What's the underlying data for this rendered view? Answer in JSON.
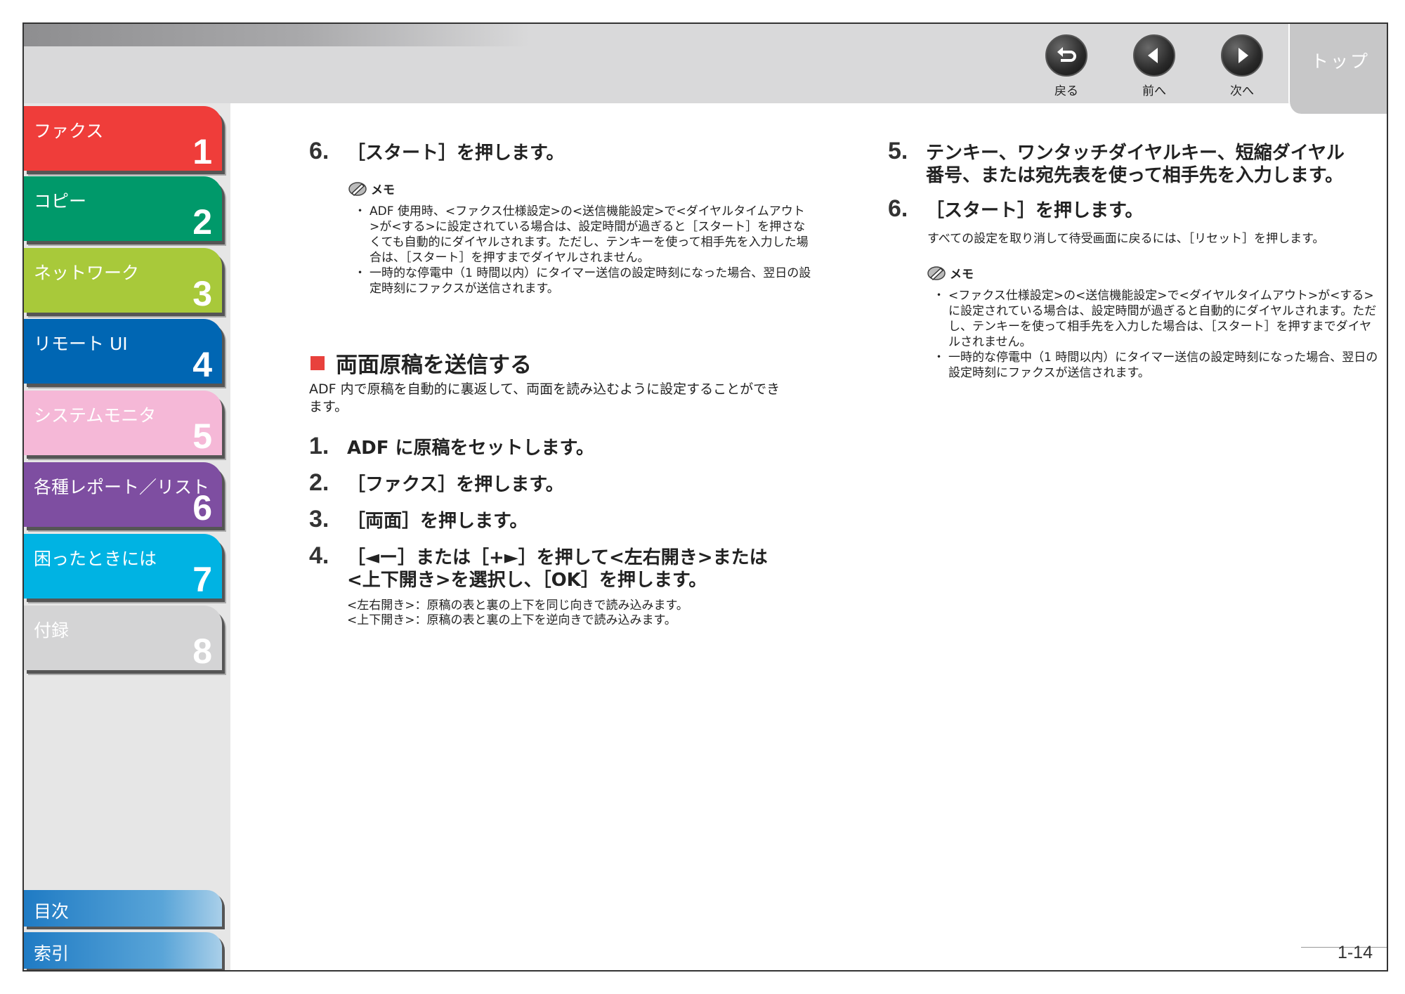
{
  "nav": {
    "back_label": "戻る",
    "prev_label": "前へ",
    "next_label": "次へ",
    "top_label": "トップ"
  },
  "sidebar": {
    "chapters": [
      {
        "name": "ファクス",
        "number": "1",
        "color": "#ef3d3a"
      },
      {
        "name": "コピー",
        "number": "2",
        "color": "#00996a"
      },
      {
        "name": "ネットワーク",
        "number": "3",
        "color": "#a8c93a"
      },
      {
        "name": "リモート UI",
        "number": "4",
        "color": "#0066b3"
      },
      {
        "name": "システムモニタ",
        "number": "5",
        "color": "#f5b8d7"
      },
      {
        "name": "各種レポート／リスト",
        "number": "6",
        "color": "#7e4ea1"
      },
      {
        "name": "困ったときには",
        "number": "7",
        "color": "#00b3e3"
      },
      {
        "name": "付録",
        "number": "8",
        "color": "#d4d4d5"
      }
    ],
    "toc_label": "目次",
    "index_label": "索引"
  },
  "left": {
    "step6_num": "6.",
    "step6_text": "［スタート］を押します。",
    "memo1_title": "メモ",
    "memo1_items": [
      "ADF 使用時、<ファクス仕様設定>の<送信機能設定>で<ダイヤルタイムアウト>が<する>に設定されている場合は、設定時間が過ぎると［スタート］を押さなくても自動的にダイヤルされます。ただし、テンキーを使って相手先を入力した場合は、［スタート］を押すまでダイヤルされません。",
      "一時的な停電中（1 時間以内）にタイマー送信の設定時刻になった場合、翌日の設定時刻にファクスが送信されます。"
    ],
    "section_title": "両面原稿を送信する",
    "section_desc": "ADF 内で原稿を自動的に裏返して、両面を読み込むように設定することができます。",
    "steps": [
      {
        "num": "1.",
        "text": "ADF に原稿をセットします。"
      },
      {
        "num": "2.",
        "text": "［ファクス］を押します。"
      },
      {
        "num": "3.",
        "text": "［両面］を押します。"
      },
      {
        "num": "4.",
        "text": "［◄ー］または［+►］を押して<左右開き>または<上下開き>を選択し、［OK］を押します。"
      }
    ],
    "step4_sub1": "<左右開き>：原稿の表と裏の上下を同じ向きで読み込みます。",
    "step4_sub2": "<上下開き>：原稿の表と裏の上下を逆向きで読み込みます。"
  },
  "right": {
    "step5_num": "5.",
    "step5_text": "テンキー、ワンタッチダイヤルキー、短縮ダイヤル番号、または宛先表を使って相手先を入力します。",
    "step6_num": "6.",
    "step6_text": "［スタート］を押します。",
    "step6_desc": "すべての設定を取り消して待受画面に戻るには、［リセット］を押します。",
    "memo2_title": "メモ",
    "memo2_items": [
      "<ファクス仕様設定>の<送信機能設定>で<ダイヤルタイムアウト>が<する>に設定されている場合は、設定時間が過ぎると自動的にダイヤルされます。ただし、テンキーを使って相手先を入力した場合は、［スタート］を押すまでダイヤルされません。",
      "一時的な停電中（1 時間以内）にタイマー送信の設定時刻になった場合、翌日の設定時刻にファクスが送信されます。"
    ]
  },
  "footer": {
    "page_number": "1-14"
  }
}
